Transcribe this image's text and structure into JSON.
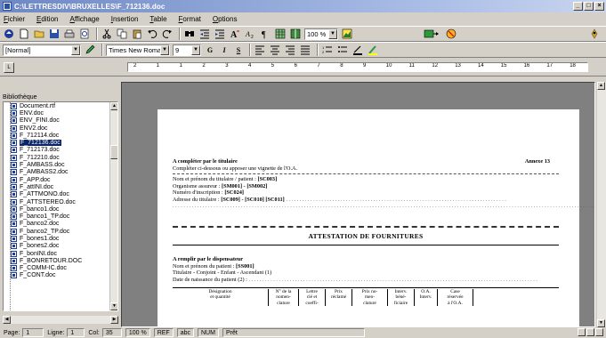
{
  "window": {
    "title": "C:\\LETTRESDIV\\BRUXELLES\\F_712136.doc"
  },
  "menu": [
    "Fichier",
    "Edition",
    "Affichage",
    "Insertion",
    "Table",
    "Format",
    "Options"
  ],
  "toolbar": {
    "zoom_value": "100 %",
    "style_value": "[Normal]",
    "font_value": "Times New Roman",
    "size_value": "9",
    "bold_label": "G",
    "italic_label": "I",
    "underline_label": "S"
  },
  "ruler": {
    "labels": [
      "2",
      "1",
      "1",
      "2",
      "3",
      "4",
      "5",
      "6",
      "7",
      "8",
      "9",
      "10",
      "11",
      "12",
      "13",
      "14",
      "15",
      "16",
      "17",
      "18"
    ]
  },
  "library": {
    "label": "Bibliothèque",
    "files": [
      "Document.rtf",
      "ENV.doc",
      "ENV_FINI.doc",
      "ENV2.doc",
      "F_712114.doc",
      "F_712136.doc",
      "F_712173.doc",
      "F_712210.doc",
      "F_AMBASS.doc",
      "F_AMBASS2.doc",
      "F_APP.doc",
      "F_attINI.doc",
      "F_ATTMONO.doc",
      "F_ATTSTEREO.doc",
      "F_banco1.doc",
      "F_banco1_TP.doc",
      "F_banco2.doc",
      "F_banco2_TP.doc",
      "F_bones1.doc",
      "F_bones2.doc",
      "F_bonINI.doc",
      "F_BONRETOUR.DOC",
      "F_COMM-IC.doc",
      "F_CONT.doc"
    ],
    "selected_index": 5
  },
  "doc": {
    "line1": "A compléter par le titulaire",
    "annexe": "Annexe 13",
    "line2": "Compléter ci-dessous ou apposer une vignette de l'O.A.",
    "nom_label": "Nom et prénom du titulaire / patient :",
    "nom_code": "[SC003]",
    "org_label": "Organisme assureur :",
    "org_code": "[SM001] - [SM002]",
    "num_label": "Numéro d'inscription :",
    "num_code": "[SC024]",
    "adr_label": "Adresse du titulaire :",
    "adr_code": "[SC009] - [SC010] [SC011]",
    "title": "ATTESTATION DE FOURNITURES",
    "disp_label": "A remplir par le dispensateur",
    "disp_nom_label": "Nom et prénom du patient :",
    "disp_nom_code": "[SS001]",
    "titulaire_line": "Titulaire - Conjoint - Enfant - Ascendant  (1)",
    "naissance_label": "Date de naissance du patient (2) :",
    "table_headers": [
      [
        "Désignation",
        "et quantité",
        ""
      ],
      [
        "N° de la",
        "nomen-",
        "clature"
      ],
      [
        "Lettre",
        "clé et",
        "coeffi-"
      ],
      [
        "Prix",
        "réclamé",
        ""
      ],
      [
        "Prix no-",
        "men-",
        "clature"
      ],
      [
        "Interv.",
        "béné-",
        "ficiaire"
      ],
      [
        "O.A.",
        "Interv.",
        ""
      ],
      [
        "Case",
        "réservée",
        "à l'O.A."
      ]
    ]
  },
  "status": {
    "page_label": "Page:",
    "page_value": "1",
    "line_label": "Ligne:",
    "line_value": "1",
    "col_label": "Col:",
    "col_value": "35",
    "zoom": "100 %",
    "ref": "REF",
    "abc": "abc",
    "num": "NUM",
    "state": "Prêt"
  },
  "colors": {
    "titlebar_start": "#6e88c4",
    "selection": "#0a246a",
    "workspace": "#808080",
    "chrome": "#d4d0c8"
  }
}
